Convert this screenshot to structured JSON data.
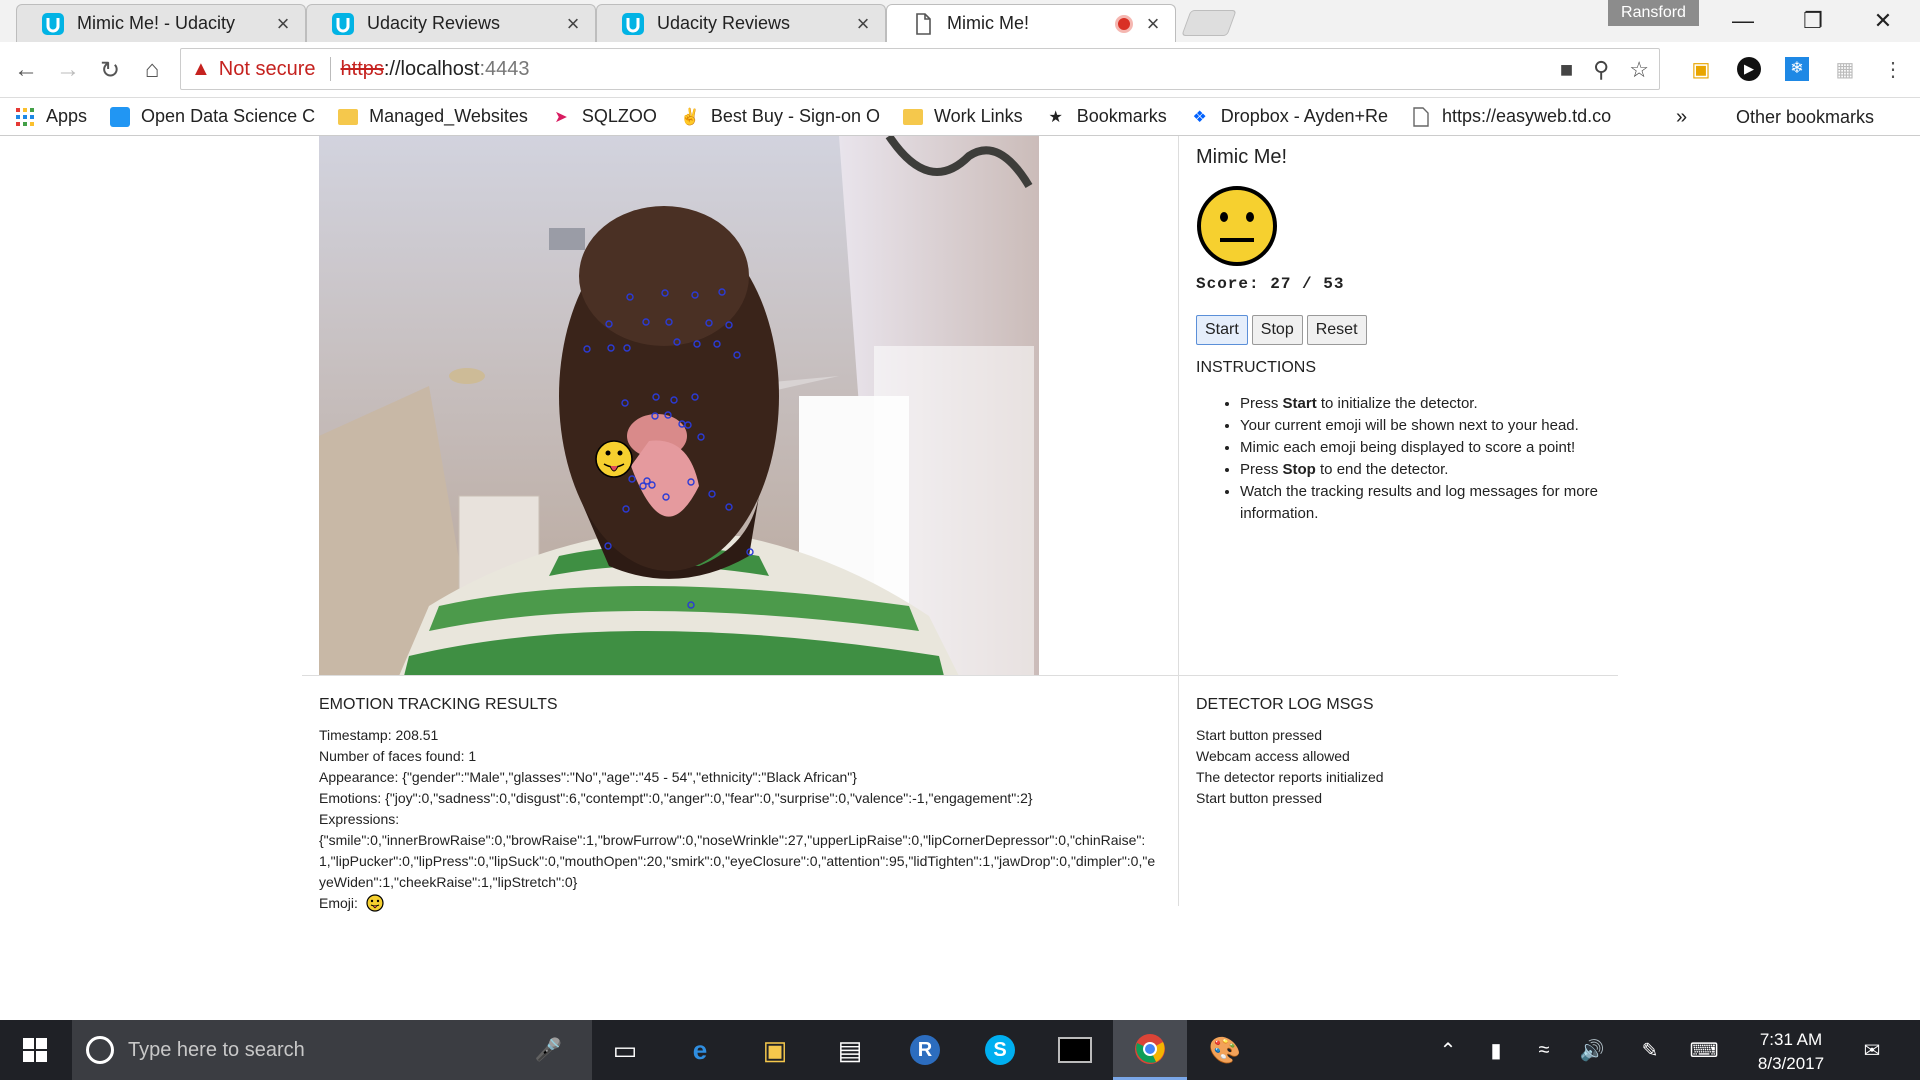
{
  "browser": {
    "tabs": [
      {
        "label": "Mimic Me! - Udacity",
        "icon": "udacity-icon",
        "active": false
      },
      {
        "label": "Udacity Reviews",
        "icon": "udacity-icon",
        "active": false
      },
      {
        "label": "Udacity Reviews",
        "icon": "udacity-icon",
        "active": false
      },
      {
        "label": "Mimic Me!",
        "icon": "page-icon",
        "active": true
      }
    ],
    "profile_name": "Ransford",
    "address": {
      "security_label": "Not secure",
      "scheme": "https",
      "host": "://localhost",
      "port": ":4443"
    },
    "bookmarks": [
      {
        "label": "Apps",
        "icon": "apps-grid-icon"
      },
      {
        "label": "Open Data Science C",
        "icon": "open-data-science-icon"
      },
      {
        "label": "Managed_Websites",
        "icon": "folder-icon"
      },
      {
        "label": "SQLZOO",
        "icon": "sqlzoo-icon"
      },
      {
        "label": "Best Buy - Sign-on O",
        "icon": "best-buy-icon"
      },
      {
        "label": "Work Links",
        "icon": "folder-icon"
      },
      {
        "label": "Bookmarks",
        "icon": "star-icon"
      },
      {
        "label": "Dropbox - Ayden+Re",
        "icon": "dropbox-icon"
      },
      {
        "label": "https://easyweb.td.co",
        "icon": "page-icon"
      }
    ],
    "bookmarks_overflow": "»",
    "other_bookmarks": "Other bookmarks"
  },
  "app": {
    "title": "Mimic Me!",
    "score_label": "Score:",
    "score_value": "27 / 53",
    "buttons": {
      "start": "Start",
      "stop": "Stop",
      "reset": "Reset"
    },
    "instructions_heading": "INSTRUCTIONS",
    "instructions": [
      {
        "pre": "Press ",
        "bold": "Start",
        "post": " to initialize the detector."
      },
      {
        "pre": "Your current emoji will be shown next to your head.",
        "bold": "",
        "post": ""
      },
      {
        "pre": "Mimic each emoji being displayed to score a point!",
        "bold": "",
        "post": ""
      },
      {
        "pre": "Press ",
        "bold": "Stop",
        "post": " to end the detector."
      },
      {
        "pre": "Watch the tracking results and log messages for more information.",
        "bold": "",
        "post": ""
      }
    ],
    "results": {
      "heading": "EMOTION TRACKING RESULTS",
      "timestamp": "Timestamp: 208.51",
      "faces": "Number of faces found: 1",
      "appearance": "Appearance: {\"gender\":\"Male\",\"glasses\":\"No\",\"age\":\"45 - 54\",\"ethnicity\":\"Black African\"}",
      "emotions": "Emotions: {\"joy\":0,\"sadness\":0,\"disgust\":6,\"contempt\":0,\"anger\":0,\"fear\":0,\"surprise\":0,\"valence\":-1,\"engagement\":2}",
      "expressions_label": "Expressions:",
      "expressions": "{\"smile\":0,\"innerBrowRaise\":0,\"browRaise\":1,\"browFurrow\":0,\"noseWrinkle\":27,\"upperLipRaise\":0,\"lipCornerDepressor\":0,\"chinRaise\":1,\"lipPucker\":0,\"lipPress\":0,\"lipSuck\":0,\"mouthOpen\":20,\"smirk\":0,\"eyeClosure\":0,\"attention\":95,\"lidTighten\":1,\"jawDrop\":0,\"dimpler\":0,\"eyeWiden\":1,\"cheekRaise\":1,\"lipStretch\":0}",
      "emoji_label": "Emoji:"
    },
    "log": {
      "heading": "DETECTOR LOG MSGS",
      "messages": [
        "Start button pressed",
        "Webcam access allowed",
        "The detector reports initialized",
        "Start button pressed"
      ]
    }
  },
  "taskbar": {
    "search_placeholder": "Type here to search",
    "apps": [
      "task-view-icon",
      "edge-icon",
      "file-explorer-icon",
      "store-icon",
      "r-icon",
      "skype-icon",
      "cmd-icon",
      "chrome-icon",
      "paint-icon"
    ],
    "time": "7:31 AM",
    "date": "8/3/2017"
  },
  "colors": {
    "accent": "#1a73e8",
    "warning": "#c5221f",
    "emoji_yellow": "#f6d02f",
    "landmark": "#2b3bd6"
  }
}
